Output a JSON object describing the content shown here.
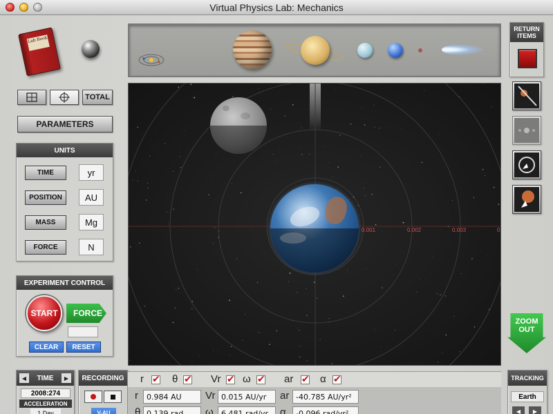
{
  "window": {
    "title": "Virtual Physics Lab: Mechanics"
  },
  "lab_book": {
    "label": "Lab Book"
  },
  "view_buttons": {
    "total": "TOTAL"
  },
  "parameters": {
    "label": "PARAMETERS"
  },
  "units": {
    "title": "UNITS",
    "rows": [
      {
        "label": "TIME",
        "value": "yr"
      },
      {
        "label": "POSITION",
        "value": "AU"
      },
      {
        "label": "MASS",
        "value": "Mg"
      },
      {
        "label": "FORCE",
        "value": "N"
      }
    ]
  },
  "experiment_control": {
    "title": "EXPERIMENT CONTROL",
    "start": "START",
    "force": "FORCE",
    "clear": "CLEAR",
    "reset": "RESET"
  },
  "return_items": {
    "label": "RETURN ITEMS"
  },
  "zoom_out": {
    "label": "ZOOM OUT"
  },
  "axis_ticks": [
    "0.001",
    "0.002",
    "0.003",
    "0"
  ],
  "time_panel": {
    "label": "TIME",
    "date": "2008:274",
    "acceleration_label": "ACCELERATION",
    "acceleration_value": "1 Day"
  },
  "recording": {
    "label": "RECORDING",
    "av_label": "V-AU"
  },
  "toggles": [
    {
      "symbol": "r"
    },
    {
      "symbol": "θ"
    },
    {
      "symbol": "Vr"
    },
    {
      "symbol": "ω"
    },
    {
      "symbol": "ar"
    },
    {
      "symbol": "α"
    }
  ],
  "readouts": {
    "r": {
      "symbol": "r",
      "value": "0.984 AU"
    },
    "vr": {
      "symbol": "Vr",
      "value": "0.015 AU/yr"
    },
    "ar": {
      "symbol": "ar",
      "value": "-40.785 AU/yr²"
    },
    "theta": {
      "symbol": "θ",
      "value": "0.139 rad"
    },
    "omega": {
      "symbol": "ω",
      "value": "6.481 rad/yr"
    },
    "alpha": {
      "symbol": "α",
      "value": "-0.096 rad/yr²"
    }
  },
  "tracking": {
    "label": "TRACKING",
    "value": "Earth"
  },
  "colors": {
    "accent_red": "#c21a1a",
    "start_red": "#c4161c",
    "force_green": "#1f8a2b",
    "panel_dark": "#3b3b3b",
    "blue_btn": "#2f6fd1"
  }
}
